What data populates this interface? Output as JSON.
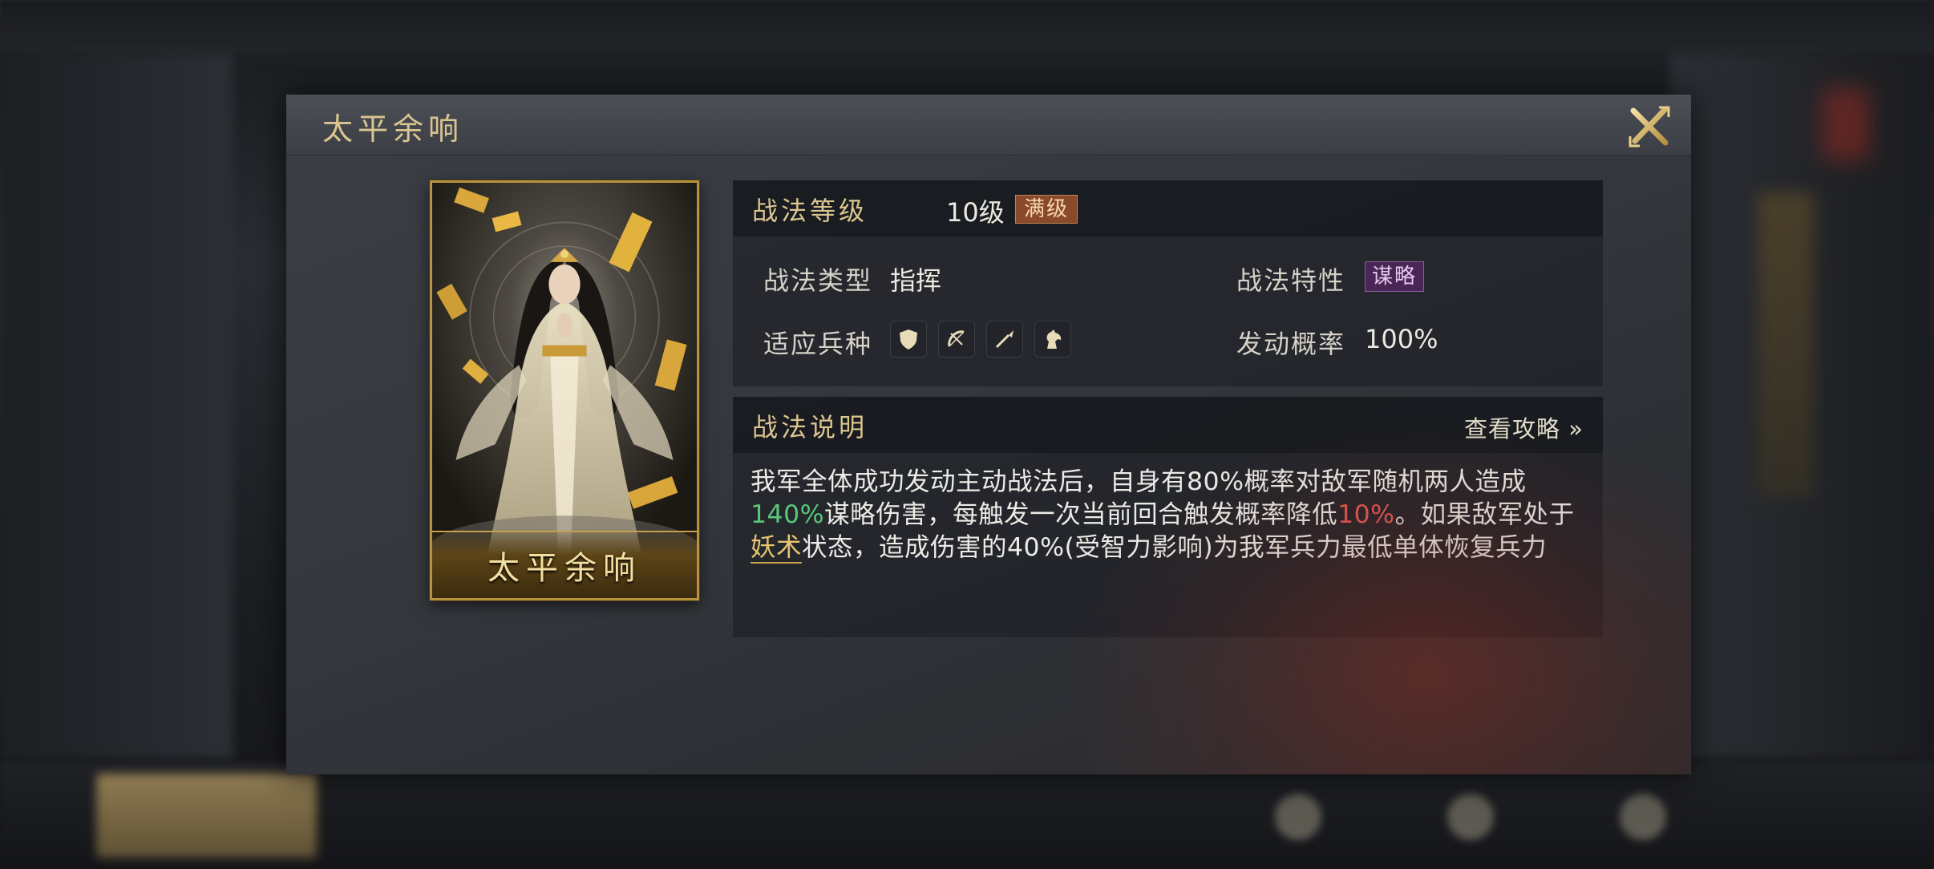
{
  "backdrop": {
    "top_label": "",
    "bottom_labels": []
  },
  "dialog": {
    "title": "太平余响"
  },
  "card": {
    "name": "太平余响"
  },
  "level_panel": {
    "level_label": "战法等级",
    "level_value": "10级",
    "level_badge": "满级",
    "type_label": "战法类型",
    "type_value": "指挥",
    "trait_label": "战法特性",
    "trait_badge": "谋略",
    "troops_label": "适应兵种",
    "troop_icons": [
      "shield-icon",
      "bow-icon",
      "spear-icon",
      "horse-icon"
    ],
    "rate_label": "发动概率",
    "rate_value": "100%"
  },
  "desc_panel": {
    "title": "战法说明",
    "guide_link": "查看攻略 »",
    "text_seg1": "我军全体成功发动主动战法后，自身有80%概率对敌军随机两人造成",
    "text_green": "140%",
    "text_seg2": "谋略伤害，每触发一次当前回合触发概率降低",
    "text_red": "10%",
    "text_seg3": "。如果敌军处于",
    "text_link": "妖术",
    "text_seg4": "状态，造成伤害的40%(受智力影响)为我军兵力最低单体恢复兵力"
  },
  "colors": {
    "gold": "#dcc690",
    "green": "#58c77a",
    "red": "#e65a52",
    "badge_full": "#8a4a2a",
    "badge_tactic": "#4a2656"
  }
}
